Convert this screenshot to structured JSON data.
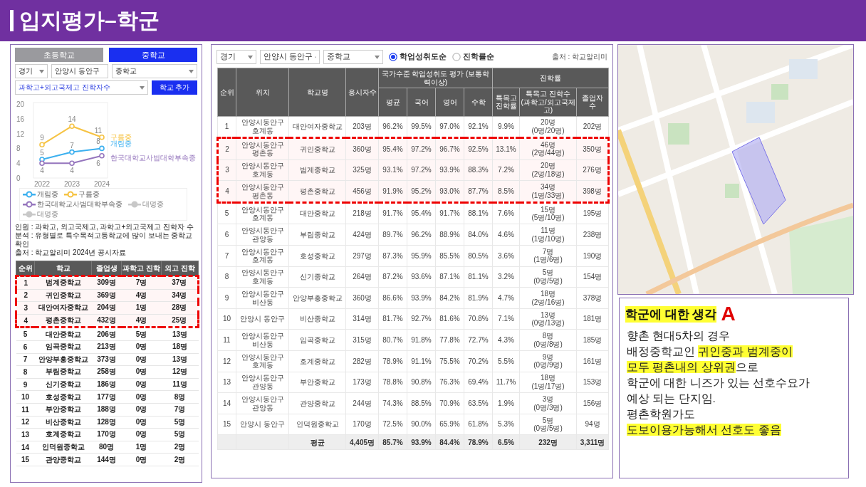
{
  "header": {
    "title": "입지평가–학군"
  },
  "left_panel": {
    "tabs": [
      {
        "label": "초등학교",
        "selected": false
      },
      {
        "label": "중학교",
        "selected": true
      }
    ],
    "filters": [
      "경기",
      "안양시 동안구",
      "중학교"
    ],
    "metric_select": "과학고+외고국제고 진학자수",
    "add_button": "학교 추가",
    "chart": {
      "chart_data": {
        "type": "line",
        "categories": [
          "2022",
          "2023",
          "2024"
        ],
        "ylim": [
          0,
          20
        ],
        "yticks": [
          0,
          4,
          8,
          12,
          16,
          20
        ],
        "data_labels": true,
        "series": [
          {
            "name": "구름중",
            "color": "#f6c343",
            "marker": "circle",
            "values": [
              9,
              14,
              11
            ]
          },
          {
            "name": "개림중",
            "color": "#3cb0ef",
            "marker": "circle",
            "values": [
              5,
              7,
              8
            ]
          },
          {
            "name": "한국대학교사범대학부속중",
            "color": "#9575bd",
            "marker": "circle",
            "values": [
              4,
              4,
              6
            ]
          }
        ]
      },
      "legend": [
        {
          "name": "개림중",
          "color": "#3cb0ef",
          "disabled": false
        },
        {
          "name": "구름중",
          "color": "#f6c343",
          "disabled": false
        },
        {
          "name": "한국대학교사범대학부속중",
          "color": "#9575bd",
          "disabled": false
        },
        {
          "name": "대명중",
          "color": "#c8c8c8",
          "disabled": true
        },
        {
          "name": "대명중",
          "color": "#c8c8c8",
          "disabled": true
        }
      ]
    },
    "notes": [
      "인원 : 과학고, 외고국제고, 과학고+외고국제고 진학자 수",
      "분석 : 유형별로 특수목적고등학교에 많이 보내는 중학교 확인",
      "출처 : 학교알리미 2024년 공시자료"
    ],
    "table": {
      "columns": [
        "순위",
        "학교",
        "졸업생",
        "과학고 진학",
        "외고 진학"
      ],
      "rows": [
        {
          "cells": [
            "1",
            "범계중학교",
            "309명",
            "7명",
            "37명"
          ],
          "highlighted": true
        },
        {
          "cells": [
            "2",
            "귀인중학교",
            "369명",
            "4명",
            "34명"
          ],
          "highlighted": true
        },
        {
          "cells": [
            "3",
            "대안여자중학교",
            "204명",
            "1명",
            "28명"
          ],
          "highlighted": true
        },
        {
          "cells": [
            "4",
            "평촌중학교",
            "432명",
            "4명",
            "25명"
          ],
          "highlighted": true
        },
        {
          "cells": [
            "5",
            "대안중학교",
            "206명",
            "5명",
            "13명"
          ],
          "highlighted": false
        },
        {
          "cells": [
            "6",
            "임곡중학교",
            "213명",
            "0명",
            "18명"
          ],
          "highlighted": false
        },
        {
          "cells": [
            "7",
            "안양부흥중학교",
            "373명",
            "0명",
            "13명"
          ],
          "highlighted": false
        },
        {
          "cells": [
            "8",
            "부림중학교",
            "258명",
            "0명",
            "12명"
          ],
          "highlighted": false
        },
        {
          "cells": [
            "9",
            "신기중학교",
            "186명",
            "0명",
            "11명"
          ],
          "highlighted": false
        },
        {
          "cells": [
            "10",
            "호성중학교",
            "177명",
            "0명",
            "8명"
          ],
          "highlighted": false
        },
        {
          "cells": [
            "11",
            "부안중학교",
            "188명",
            "0명",
            "7명"
          ],
          "highlighted": false
        },
        {
          "cells": [
            "12",
            "비산중학교",
            "128명",
            "0명",
            "5명"
          ],
          "highlighted": false
        },
        {
          "cells": [
            "13",
            "호계중학교",
            "170명",
            "0명",
            "5명"
          ],
          "highlighted": false
        },
        {
          "cells": [
            "14",
            "인덕원중학교",
            "80명",
            "1명",
            "2명"
          ],
          "highlighted": false
        },
        {
          "cells": [
            "15",
            "관양중학교",
            "144명",
            "0명",
            "2명"
          ],
          "highlighted": false
        }
      ]
    }
  },
  "middle_panel": {
    "filters": [
      "경기",
      "안양시 동안구",
      "중학교"
    ],
    "sort_options": [
      {
        "label": "학업성취도순",
        "selected": true
      },
      {
        "label": "진학률순",
        "selected": false
      }
    ],
    "source": "출처 : 학교알리미",
    "table": {
      "header": [
        {
          "label": "순위"
        },
        {
          "label": "위치"
        },
        {
          "label": "학교명"
        },
        {
          "label": "응시자수"
        },
        {
          "label": "국가수준 학업성취도 평가 (보통학력이상)",
          "columns": [
            {
              "label": "평균"
            },
            {
              "label": "국어"
            },
            {
              "label": "영어"
            },
            {
              "label": "수학"
            }
          ]
        },
        {
          "label": "진학률",
          "columns": [
            {
              "label": "특목고 진학률"
            },
            {
              "label": "특목고 진학수",
              "note": "(과학고/외고국제고)"
            },
            {
              "label": "졸업자 수"
            }
          ]
        }
      ],
      "rows": [
        {
          "cells": [
            "1",
            "안양시동안구 호계동",
            "대안여자중학교",
            "203명",
            "96.2%",
            "99.5%",
            "97.0%",
            "92.1%",
            "9.9%",
            "20명\n(0명/20명)",
            "202명"
          ],
          "highlighted": false
        },
        {
          "cells": [
            "2",
            "안양시동안구 평촌동",
            "귀인중학교",
            "360명",
            "95.4%",
            "97.2%",
            "96.7%",
            "92.5%",
            "13.1%",
            "46명\n(2명/44명)",
            "350명"
          ],
          "highlighted": true
        },
        {
          "cells": [
            "3",
            "안양시동안구 호계동",
            "범계중학교",
            "325명",
            "93.1%",
            "97.2%",
            "93.9%",
            "88.3%",
            "7.2%",
            "20명\n(2명/18명)",
            "276명"
          ],
          "highlighted": true
        },
        {
          "cells": [
            "4",
            "안양시동안구 평촌동",
            "평촌중학교",
            "456명",
            "91.9%",
            "95.2%",
            "93.0%",
            "87.7%",
            "8.5%",
            "34명\n(1명/33명)",
            "398명"
          ],
          "highlighted": true
        },
        {
          "cells": [
            "5",
            "안양시동안구 호계동",
            "대안중학교",
            "218명",
            "91.7%",
            "95.4%",
            "91.7%",
            "88.1%",
            "7.6%",
            "15명\n(5명/10명)",
            "195명"
          ],
          "highlighted": false
        },
        {
          "cells": [
            "6",
            "안양시동안구 관양동",
            "부림중학교",
            "424명",
            "89.7%",
            "96.2%",
            "88.9%",
            "84.0%",
            "4.6%",
            "11명\n(1명/10명)",
            "238명"
          ],
          "highlighted": false
        },
        {
          "cells": [
            "7",
            "안양시동안구 호계동",
            "호성중학교",
            "297명",
            "87.3%",
            "95.9%",
            "85.5%",
            "80.5%",
            "3.6%",
            "7명\n(1명/6명)",
            "190명"
          ],
          "highlighted": false
        },
        {
          "cells": [
            "8",
            "안양시동안구 호계동",
            "신기중학교",
            "264명",
            "87.2%",
            "93.6%",
            "87.1%",
            "81.1%",
            "3.2%",
            "5명\n(0명/5명)",
            "154명"
          ],
          "highlighted": false
        },
        {
          "cells": [
            "9",
            "안양시동안구 비산동",
            "안양부흥중학교",
            "360명",
            "86.6%",
            "93.9%",
            "84.2%",
            "81.9%",
            "4.7%",
            "18명\n(2명/16명)",
            "378명"
          ],
          "highlighted": false
        },
        {
          "cells": [
            "10",
            "안양시 동안구",
            "비산중학교",
            "314명",
            "81.7%",
            "92.7%",
            "81.6%",
            "70.8%",
            "7.1%",
            "13명\n(0명/13명)",
            "181명"
          ],
          "highlighted": false
        },
        {
          "cells": [
            "11",
            "안양시동안구 비산동",
            "임곡중학교",
            "315명",
            "80.7%",
            "91.8%",
            "77.8%",
            "72.7%",
            "4.3%",
            "8명\n(0명/8명)",
            "185명"
          ],
          "highlighted": false
        },
        {
          "cells": [
            "12",
            "안양시동안구 호계동",
            "호계중학교",
            "282명",
            "78.9%",
            "91.1%",
            "75.5%",
            "70.2%",
            "5.5%",
            "9명\n(0명/9명)",
            "161명"
          ],
          "highlighted": false
        },
        {
          "cells": [
            "13",
            "안양시동안구 관양동",
            "부안중학교",
            "173명",
            "78.8%",
            "90.8%",
            "76.3%",
            "69.4%",
            "11.7%",
            "18명\n(1명/17명)",
            "153명"
          ],
          "highlighted": false
        },
        {
          "cells": [
            "14",
            "안양시동안구 관양동",
            "관양중학교",
            "244명",
            "74.3%",
            "88.5%",
            "70.9%",
            "63.5%",
            "1.9%",
            "3명\n(0명/3명)",
            "156명"
          ],
          "highlighted": false
        },
        {
          "cells": [
            "15",
            "안양시 동안구",
            "인덕원중학교",
            "170명",
            "72.5%",
            "90.0%",
            "65.9%",
            "61.8%",
            "5.3%",
            "5명\n(0명/5명)",
            "94명"
          ],
          "highlighted": false
        }
      ],
      "footer": {
        "label": "평균",
        "cells": [
          "4,405명",
          "85.7%",
          "93.9%",
          "84.4%",
          "78.9%",
          "6.5%",
          "232명",
          "3,311명"
        ]
      }
    }
  },
  "note_box": {
    "title": "학군에 대한 생각",
    "marker": "A",
    "lines": [
      {
        "segments": [
          {
            "text": "향촌 현대5차의 경우",
            "highlight": false
          }
        ]
      },
      {
        "segments": [
          {
            "text": "배정중학교인 ",
            "highlight": false
          },
          {
            "text": "귀인중과 범계중이",
            "highlight": true
          }
        ]
      },
      {
        "segments": [
          {
            "text": "모두 평촌내의 상위권",
            "highlight": true
          },
          {
            "text": "으로",
            "highlight": false
          }
        ]
      },
      {
        "segments": [
          {
            "text": "학군에 대한 니즈가 있는 선호수요가",
            "highlight": false
          }
        ]
      },
      {
        "segments": [
          {
            "text": "예상 되는 단지임.",
            "highlight": false
          }
        ]
      },
      {
        "segments": [
          {
            "text": "평촌학원가도",
            "highlight": false
          }
        ]
      },
      {
        "segments": [
          {
            "text": "도보이용가능해서 선호도 좋음",
            "highlight": true
          }
        ]
      }
    ]
  }
}
